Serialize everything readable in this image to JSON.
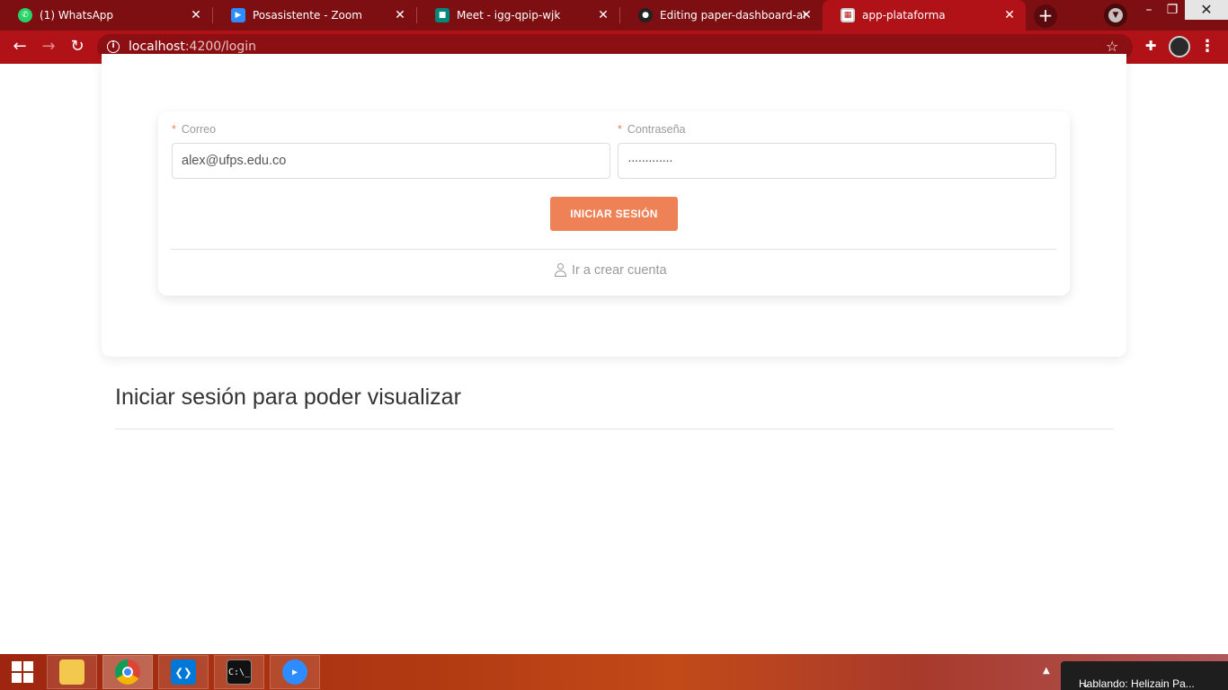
{
  "browser": {
    "tabs": [
      {
        "title": "(1) WhatsApp",
        "icon": "whatsapp-icon",
        "color": "#25d366"
      },
      {
        "title": "Posasistente - Zoom",
        "icon": "zoom-icon",
        "color": "#2d8cff"
      },
      {
        "title": "Meet - igg-qpip-wjk",
        "icon": "meet-icon",
        "color": "#00897b"
      },
      {
        "title": "Editing paper-dashboard-angu",
        "icon": "github-icon",
        "color": "#222222"
      },
      {
        "title": "app-plataforma",
        "icon": "app-icon",
        "color": "#d0d0d0",
        "active": true
      }
    ],
    "url_host": "localhost",
    "url_path": ":4200/login",
    "accent": "#b01217"
  },
  "login": {
    "email_label": "Correo",
    "email_value": "alex@ufps.edu.co",
    "password_label": "Contraseña",
    "password_value": "·············",
    "required_mark": "*",
    "submit_label": "INICIAR SESIÓN",
    "create_account_label": "Ir a crear cuenta",
    "button_color": "#ef8157"
  },
  "main": {
    "heading": "Iniciar sesión para poder visualizar"
  },
  "taskbar": {
    "apps": [
      {
        "name": "file-explorer-icon"
      },
      {
        "name": "chrome-icon",
        "active": true
      },
      {
        "name": "vscode-icon"
      },
      {
        "name": "terminal-icon",
        "text": "C:\\_"
      },
      {
        "name": "zoom-icon"
      }
    ],
    "notification": "Hablando: Helizain Pa..."
  }
}
